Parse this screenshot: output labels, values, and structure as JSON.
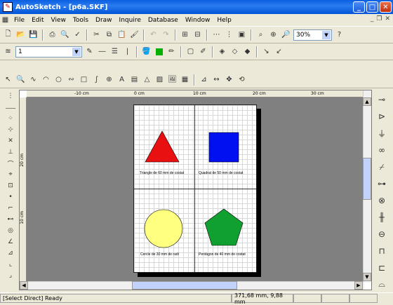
{
  "window": {
    "title": "AutoSketch - [p6a.SKF]",
    "minimize": "_",
    "maximize": "□",
    "close": "✕"
  },
  "menu": [
    "File",
    "Edit",
    "View",
    "Tools",
    "Draw",
    "Inquire",
    "Database",
    "Window",
    "Help"
  ],
  "toolbar1": {
    "zoom": "30%"
  },
  "toolbar2": {
    "layer": "1"
  },
  "rulers": {
    "h_ticks": [
      "-10 cm",
      "0 cm",
      "10 cm",
      "20 cm",
      "30 cm"
    ],
    "v_ticks": [
      "20 cm",
      "10 cm"
    ]
  },
  "drawing": {
    "shapes": [
      {
        "shape": "triangle",
        "color": "#e81010",
        "caption": "Triangle de 60 mm de costat"
      },
      {
        "shape": "square",
        "color": "#0010f0",
        "caption": "Quadrat de 50 mm de costat"
      },
      {
        "shape": "circle",
        "color": "#ffff80",
        "caption": "Cercle de 30 mm de radi"
      },
      {
        "shape": "pentagon",
        "color": "#10a030",
        "caption": "Pentàgon de 40 mm de costat"
      }
    ]
  },
  "status": {
    "mode": "[Select Direct] Ready",
    "coords": "371,68 mm, 9,88 mm"
  }
}
